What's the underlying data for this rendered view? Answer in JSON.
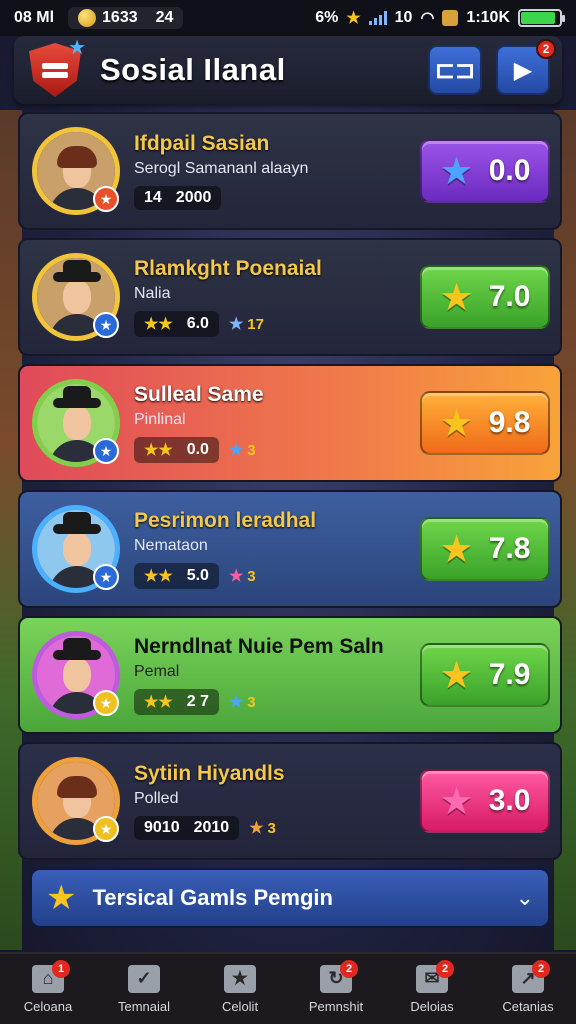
{
  "status_bar": {
    "time": "08 Ml",
    "coins": "1633",
    "coins_extra": "24",
    "battery_pct_text": "6%",
    "clock": "1:10K",
    "signal_text": "10",
    "battery_level": 0.9
  },
  "header": {
    "title": "Sosial Ilanal",
    "btn1_icon": "filter-icon",
    "btn2_icon": "play-icon",
    "btn2_badge": "2"
  },
  "players": [
    {
      "name": "Ifdpail Sasian",
      "subtitle": "Serogl Samananl alaayn",
      "stat_left": "14",
      "stat_right": "2000",
      "score": "0.0",
      "score_color": "purple",
      "star_color": "#4da3ff",
      "theme": "dark"
    },
    {
      "name": "Rlamkght Poenaial",
      "subtitle": "Nalia",
      "stat_left": "★★",
      "stat_right": "6.0",
      "extra": "17",
      "score": "7.0",
      "score_color": "green",
      "star_color": "#f7c51e",
      "theme": "dark"
    },
    {
      "name": "Sulleal Same",
      "subtitle": "Pinlinal",
      "stat_left": "★★",
      "stat_right": "0.0",
      "extra": "3",
      "score": "9.8",
      "score_color": "orange",
      "star_color": "#f7c51e",
      "theme": "red"
    },
    {
      "name": "Pesrimon leradhal",
      "subtitle": "Nemataon",
      "stat_left": "★★",
      "stat_right": "5.0",
      "extra": "3",
      "score": "7.8",
      "score_color": "green",
      "star_color": "#f7c51e",
      "theme": "blue"
    },
    {
      "name": "Nerndlnat Nuie Pem Saln",
      "subtitle": "Pemal",
      "stat_left": "★★",
      "stat_right": "2 7",
      "extra": "3",
      "score": "7.9",
      "score_color": "green",
      "star_color": "#f7c51e",
      "theme": "green"
    },
    {
      "name": "Sytiin Hiyandls",
      "subtitle": "Polled",
      "stat_left": "9010",
      "stat_right": "2010",
      "extra": "3",
      "score": "3.0",
      "score_color": "pink",
      "star_color": "#ff6ab0",
      "theme": "dark2"
    }
  ],
  "footer_bar": {
    "label": "Tersical Gamls Pemgin"
  },
  "bottom_nav": [
    {
      "label": "Celoana",
      "icon": "home-icon",
      "badge": "1"
    },
    {
      "label": "Temnaial",
      "icon": "checklist-icon",
      "badge": ""
    },
    {
      "label": "Celolit",
      "icon": "star-icon",
      "badge": ""
    },
    {
      "label": "Pemnshit",
      "icon": "refresh-icon",
      "badge": "2"
    },
    {
      "label": "Deloias",
      "icon": "mail-icon",
      "badge": "2"
    },
    {
      "label": "Cetanias",
      "icon": "chart-icon",
      "badge": "2"
    }
  ]
}
